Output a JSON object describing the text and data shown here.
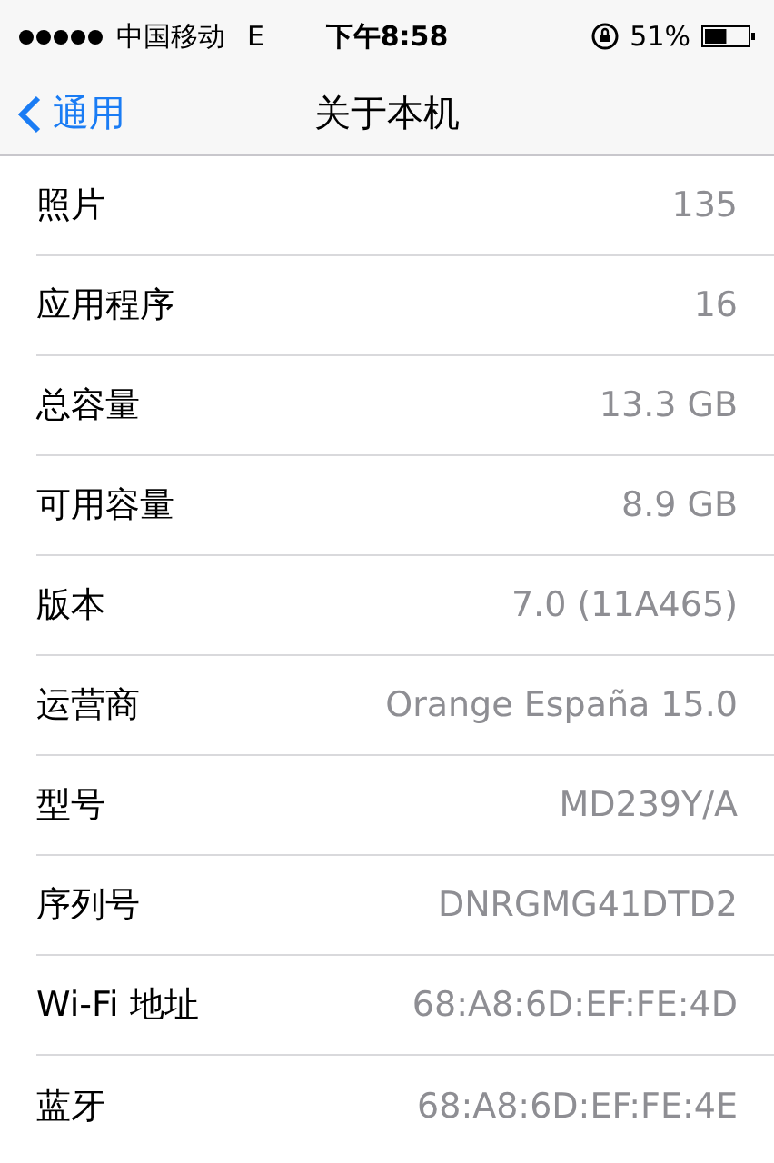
{
  "status_bar": {
    "carrier": "中国移动",
    "network": "E",
    "time": "下午8:58",
    "battery_text": "51%",
    "battery": {
      "level": 0.51
    }
  },
  "nav": {
    "back": "通用",
    "title": "关于本机"
  },
  "rows": [
    {
      "label": "照片",
      "value": "135"
    },
    {
      "label": "应用程序",
      "value": "16"
    },
    {
      "label": "总容量",
      "value": "13.3 GB"
    },
    {
      "label": "可用容量",
      "value": "8.9 GB"
    },
    {
      "label": "版本",
      "value": "7.0 (11A465)"
    },
    {
      "label": "运营商",
      "value": "Orange España 15.0"
    },
    {
      "label": "型号",
      "value": "MD239Y/A"
    },
    {
      "label": "序列号",
      "value": "DNRGMG41DTD2"
    },
    {
      "label": "Wi-Fi 地址",
      "value": "68:A8:6D:EF:FE:4D"
    },
    {
      "label": "蓝牙",
      "value": "68:A8:6D:EF:FE:4E"
    }
  ]
}
